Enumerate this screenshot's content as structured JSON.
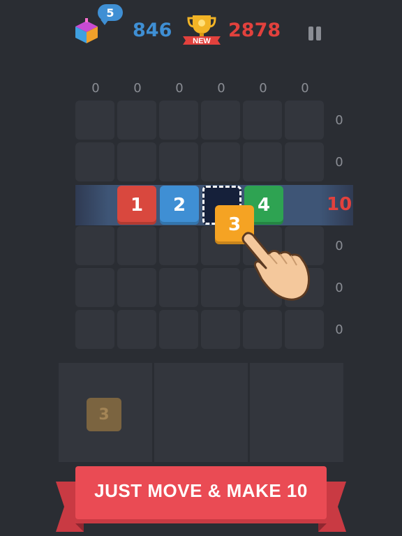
{
  "hud": {
    "gift_badge": "5",
    "score": "846",
    "best": "2878",
    "new_label": "NEW"
  },
  "icons": {
    "gift": "gift-box-icon",
    "trophy": "trophy-icon",
    "pause": "pause-icon",
    "hand": "pointing-hand-icon"
  },
  "colors": {
    "tile_1": "#d9483e",
    "tile_2": "#3f8fd4",
    "tile_3": "#f5a323",
    "tile_4": "#2ea352",
    "highlight_row_sum": "#e2413d",
    "ribbon": "#ea4b54"
  },
  "column_sums": [
    "0",
    "0",
    "0",
    "0",
    "0",
    "0"
  ],
  "row_sums": [
    "0",
    "0",
    "10",
    "0",
    "0",
    "0"
  ],
  "tiles": {
    "t1": "1",
    "t2": "2",
    "t4": "4",
    "dragged": "3"
  },
  "tray": {
    "ghost_tile": "3"
  },
  "banner": {
    "text": "JUST MOVE & MAKE 10"
  }
}
